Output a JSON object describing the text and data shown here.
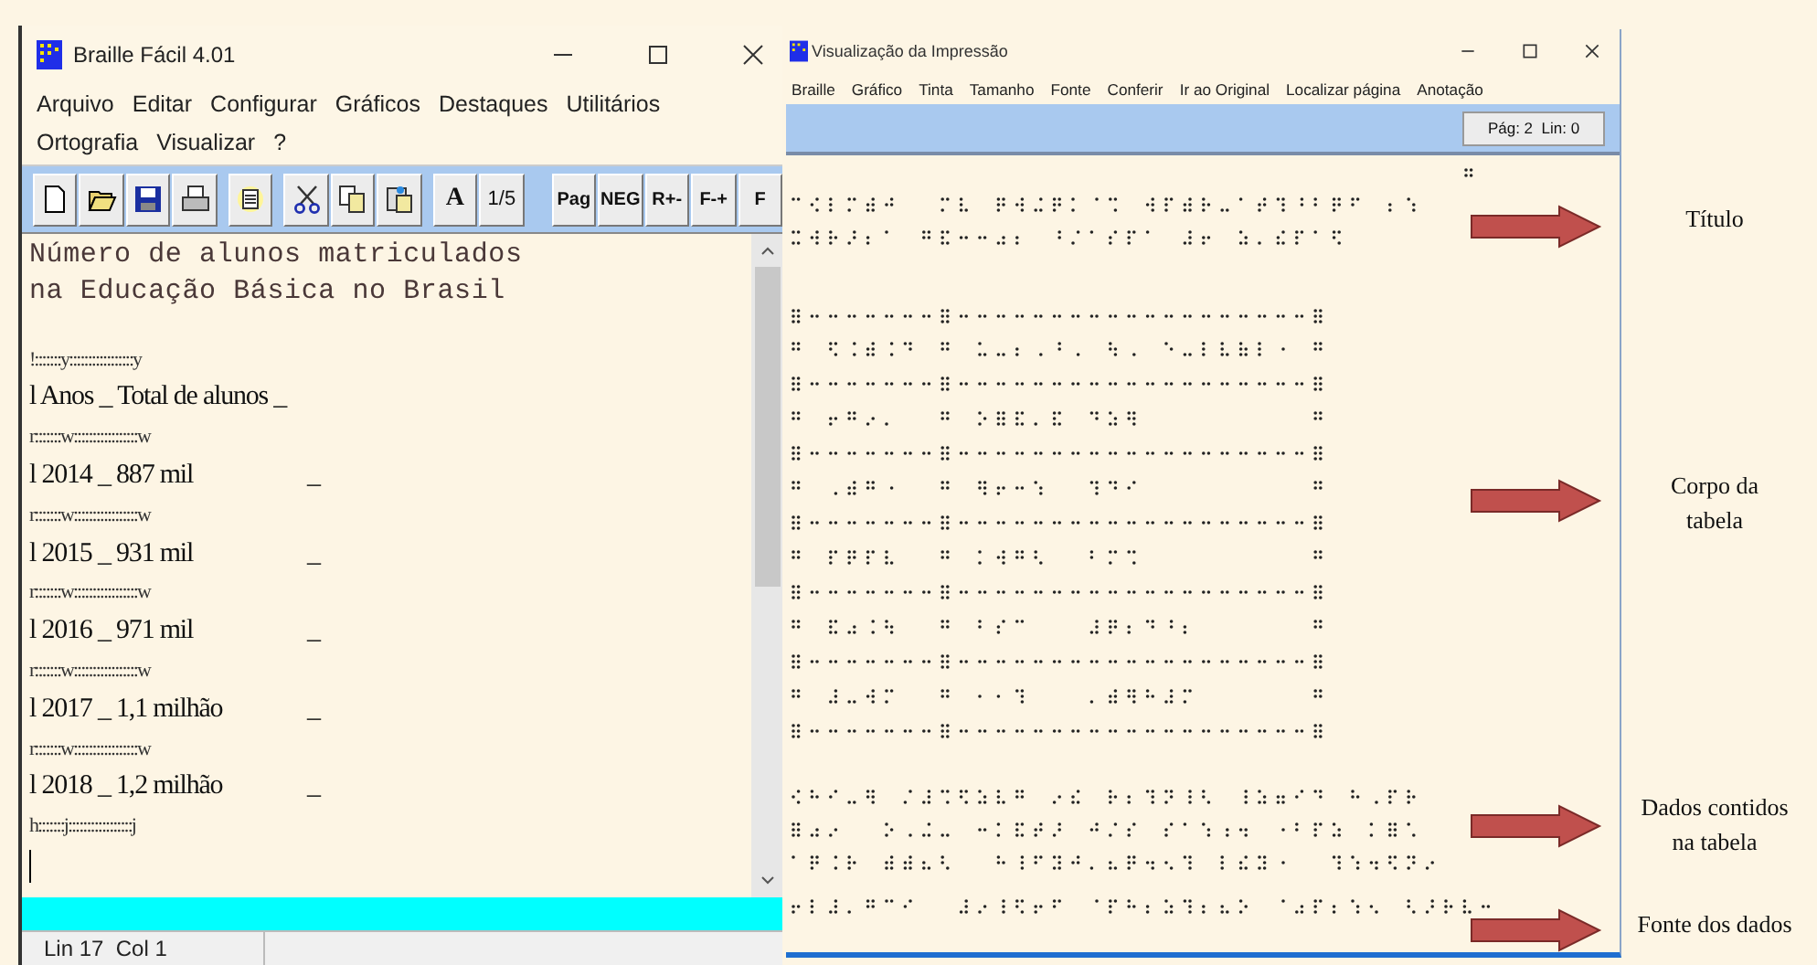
{
  "editor_window": {
    "title": "Braille Fácil 4.01",
    "menu": [
      [
        "Arquivo",
        "Editar",
        "Configurar",
        "Gráficos",
        "Destaques",
        "Utilitários"
      ],
      [
        "Ortografia",
        "Visualizar",
        "?"
      ]
    ],
    "toolbar_text_1": [
      "A",
      "1/5"
    ],
    "toolbar_text_2": [
      "Pag",
      "NEG",
      "R+-",
      "F-+",
      "F"
    ],
    "title_lines": [
      "Número de alunos matriculados",
      "na Educação Básica no Brasil"
    ],
    "table_lines": [
      {
        "text": "!:::::::y:::::::::::::::::y"
      },
      {
        "text": "l Anos _ Total de alunos _"
      },
      {
        "text": "r:::::::w:::::::::::::::::w"
      },
      {
        "text": "l 2014 _ 887 mil",
        "tail": "_"
      },
      {
        "text": "r:::::::w:::::::::::::::::w"
      },
      {
        "text": "l 2015 _ 931 mil",
        "tail": "_"
      },
      {
        "text": "r:::::::w:::::::::::::::::w"
      },
      {
        "text": "l 2016 _ 971 mil",
        "tail": "_"
      },
      {
        "text": "r:::::::w:::::::::::::::::w"
      },
      {
        "text": "l 2017 _ 1,1 milhão",
        "tail": "_"
      },
      {
        "text": "r:::::::w:::::::::::::::::w"
      },
      {
        "text": "l 2018 _ 1,2 milhão",
        "tail": "_"
      },
      {
        "text": "h:::::::j:::::::::::::::::j"
      }
    ],
    "status": "Lin 17  Col 1"
  },
  "preview_window": {
    "title": "Visualização da Impressão",
    "menu": [
      "Braille",
      "Gráfico",
      "Tinta",
      "Tamanho",
      "Fonte",
      "Conferir",
      "Ir ao Original",
      "Localizar página",
      "Anotação"
    ],
    "page_button": "Pág: 2  Lin: 0"
  },
  "annotations": [
    {
      "lines": [
        "Título"
      ]
    },
    {
      "lines": [
        "Corpo da",
        "tabela"
      ]
    },
    {
      "lines": [
        "Dados contidos",
        "na tabela"
      ]
    },
    {
      "lines": [
        "Fonte dos dados"
      ]
    }
  ]
}
